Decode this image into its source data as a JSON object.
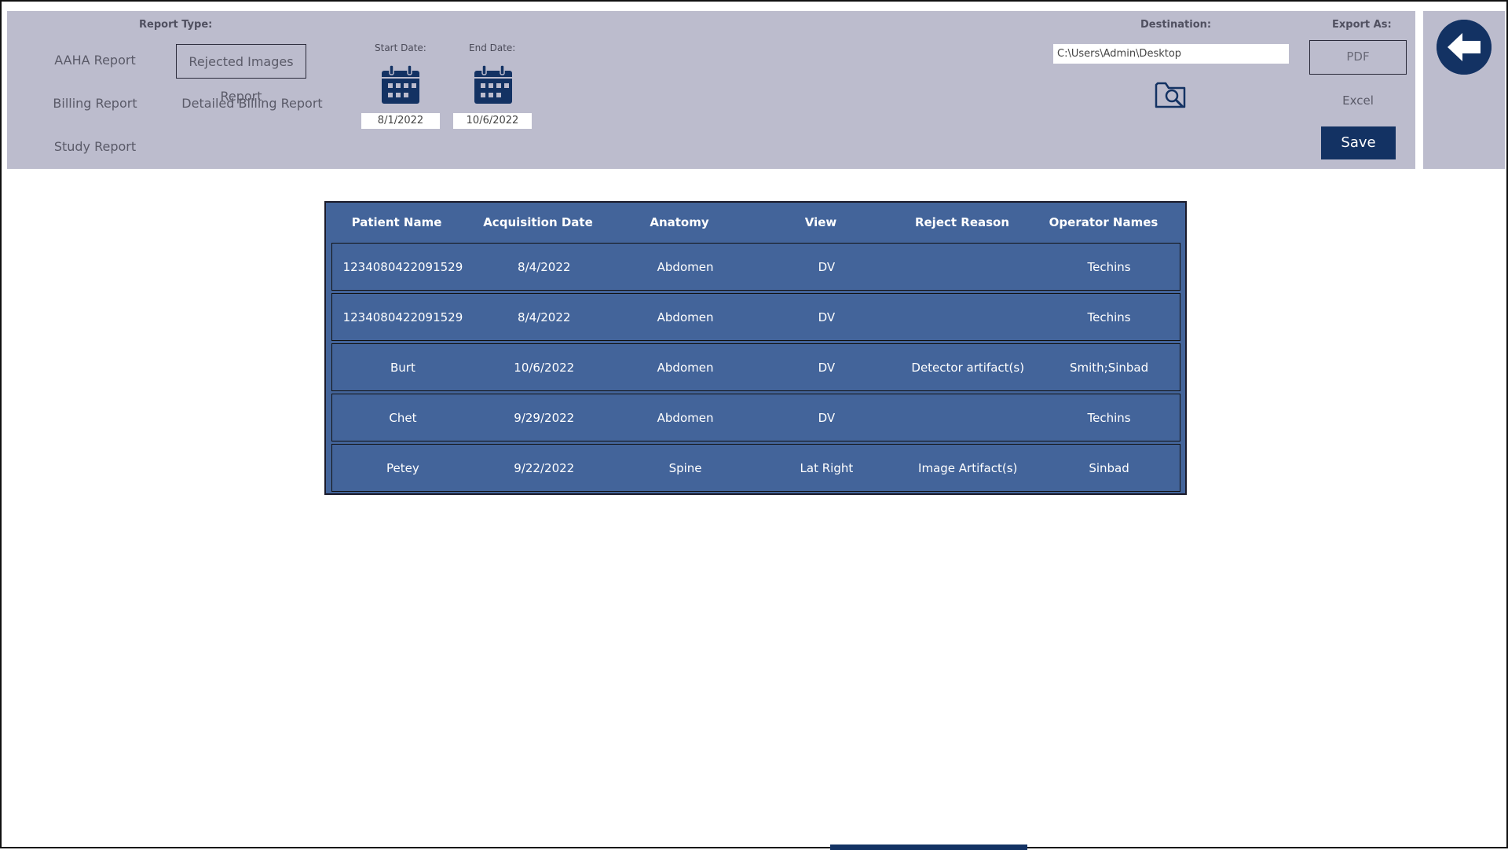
{
  "report_type": {
    "heading": "Report Type:",
    "options": [
      {
        "label": "AAHA Report"
      },
      {
        "label": "Rejected Images Report"
      },
      {
        "label": "Billing Report"
      },
      {
        "label": "Detailed Billing Report"
      },
      {
        "label": "Study Report"
      }
    ],
    "selected": "Rejected Images Report"
  },
  "dates": {
    "start_label": "Start Date:",
    "start_value": "8/1/2022",
    "end_label": "End Date:",
    "end_value": "10/6/2022"
  },
  "destination": {
    "label": "Destination:",
    "path": "C:\\Users\\Admin\\Desktop"
  },
  "export": {
    "label": "Export As:",
    "pdf": "PDF",
    "excel": "Excel",
    "save": "Save"
  },
  "table": {
    "headers": [
      "Patient Name",
      "Acquisition Date",
      "Anatomy",
      "View",
      "Reject Reason",
      "Operator Names"
    ],
    "rows": [
      [
        "1234080422091529",
        "8/4/2022",
        "Abdomen",
        "DV",
        "",
        "Techins"
      ],
      [
        "1234080422091529",
        "8/4/2022",
        "Abdomen",
        "DV",
        "",
        "Techins"
      ],
      [
        "Burt",
        "10/6/2022",
        "Abdomen",
        "DV",
        "Detector artifact(s)",
        "Smith;Sinbad"
      ],
      [
        "Chet",
        "9/29/2022",
        "Abdomen",
        "DV",
        "",
        "Techins"
      ],
      [
        "Petey",
        "9/22/2022",
        "Spine",
        "Lat Right",
        "Image Artifact(s)",
        "Sinbad"
      ]
    ]
  },
  "icons": {
    "calendar": "calendar-icon",
    "browse": "folder-search-icon",
    "back": "back-arrow-icon"
  },
  "colors": {
    "panel_bg": "#bcbccd",
    "accent_navy": "#133263",
    "table_bg": "#43649a"
  }
}
